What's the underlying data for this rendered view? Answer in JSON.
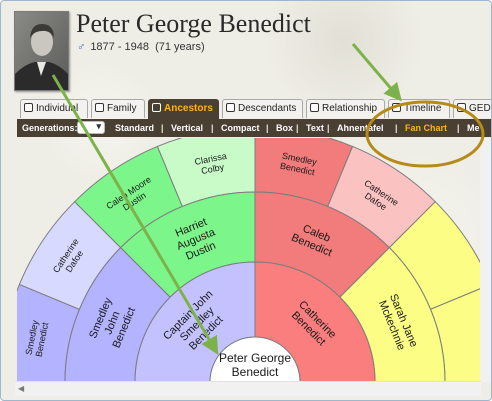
{
  "person": {
    "name": "Peter George Benedict",
    "gender_symbol": "♂",
    "lifespan": "1877 - 1948",
    "age": "(71 years)"
  },
  "tabs": [
    {
      "label": "Individual",
      "icon": "person-icon"
    },
    {
      "label": "Family",
      "icon": "family-icon"
    },
    {
      "label": "Ancestors",
      "icon": "ancestors-icon",
      "active": true
    },
    {
      "label": "Descendants",
      "icon": "descendants-icon"
    },
    {
      "label": "Relationship",
      "icon": "relationship-icon"
    },
    {
      "label": "Timeline",
      "icon": "timeline-icon"
    },
    {
      "label": "GEDC",
      "icon": "gedcom-icon"
    }
  ],
  "subnav": {
    "generations_label": "Generations:",
    "generations_value": "",
    "items": [
      "Standard",
      "Vertical",
      "Compact",
      "Box",
      "Text",
      "Ahnentafel",
      "Fan Chart",
      "Me"
    ],
    "active": "Fan Chart",
    "separator": "|"
  },
  "fan": {
    "center": {
      "line1": "Peter George",
      "line2": "Benedict"
    },
    "gen1": [
      {
        "lines": [
          "Captain John",
          "Smedley",
          "Benedict"
        ]
      },
      {
        "lines": [
          "Catherine",
          "Benedict"
        ]
      }
    ],
    "gen2": [
      {
        "lines": [
          "Smedley",
          "John",
          "Benedict"
        ]
      },
      {
        "lines": [
          "Harriet",
          "Augusta",
          "Dustin"
        ]
      },
      {
        "lines": [
          "Caleb",
          "Benedict"
        ]
      },
      {
        "lines": [
          "Sarah Jane",
          "Mckechnie"
        ]
      }
    ],
    "gen3": [
      {
        "lines": [
          "Smedley",
          "Benedict"
        ]
      },
      {
        "lines": [
          "Catherine",
          "Dafoe"
        ]
      },
      {
        "lines": [
          "Caleb Moore",
          "Dustin"
        ]
      },
      {
        "lines": [
          "Clarissa",
          "Colby"
        ]
      },
      {
        "lines": [
          "Smedley",
          "Benedict"
        ]
      },
      {
        "lines": [
          "Catherine",
          "Dafoe"
        ]
      },
      {
        "lines": [
          ""
        ]
      },
      {
        "lines": [
          ""
        ]
      }
    ]
  },
  "colors": {
    "paternal_line": "#c3c2ff",
    "paternal_father": "#b3b3ff",
    "paternal_mother": "#7cf58a",
    "paternal_dafoe": "#d8d9ff",
    "paternal_clarissa": "#c9fbc9",
    "maternal_father": "#f27b7b",
    "maternal_line": "#fa7e7e",
    "maternal_mother": "#fbfd84",
    "maternal_dafoe": "#fbc2c2",
    "arrow": "#7db24a",
    "highlight": "#b58a18",
    "toolbar": "#4a3f33",
    "active_text": "#ffb21a"
  }
}
